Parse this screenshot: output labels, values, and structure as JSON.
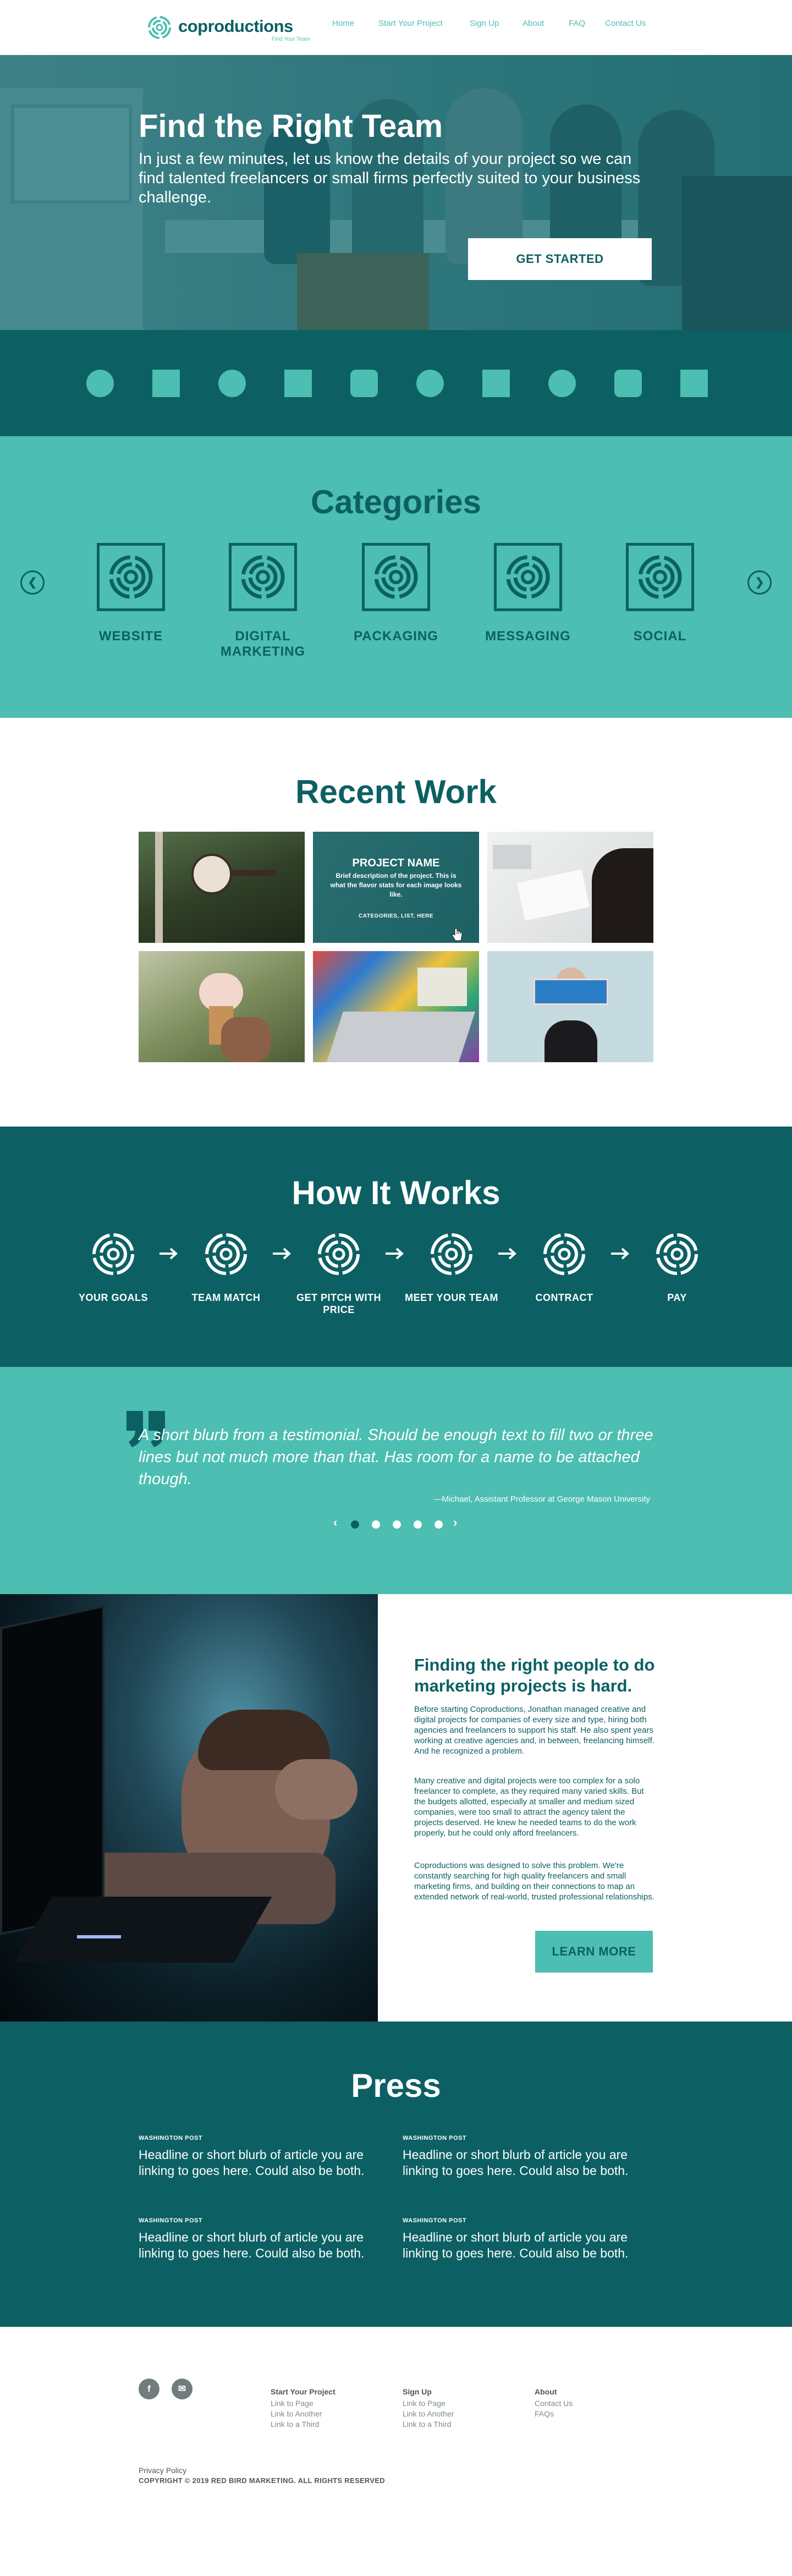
{
  "brand": {
    "name": "coproductions",
    "tagline": "Find Your Team",
    "colors": {
      "dark_teal": "#0c6063",
      "teal": "#4cbeb2",
      "white": "#ffffff",
      "gray": "#717c7c"
    }
  },
  "nav": {
    "items": [
      {
        "label": "Home"
      },
      {
        "label": "Start Your Project"
      },
      {
        "label": "Sign Up"
      },
      {
        "label": "About"
      },
      {
        "label": "FAQ"
      },
      {
        "label": "Contact Us"
      }
    ]
  },
  "hero": {
    "title": "Find the Right Team",
    "subtitle": "In just a few minutes, let us know the details of your project so we can find talented freelancers or small firms perfectly suited to your business challenge.",
    "cta_label": "GET STARTED"
  },
  "client_strip": {
    "shapes": [
      "circle",
      "square",
      "circle",
      "square",
      "rounded-square",
      "circle",
      "square",
      "circle",
      "rounded-square",
      "square"
    ]
  },
  "categories": {
    "title": "Categories",
    "prev_icon": "chevron-left-icon",
    "next_icon": "chevron-right-icon",
    "items": [
      {
        "label": "WEBSITE"
      },
      {
        "label": "DIGITAL MARKETING"
      },
      {
        "label": "PACKAGING"
      },
      {
        "label": "MESSAGING"
      },
      {
        "label": "SOCIAL"
      }
    ]
  },
  "recent_work": {
    "title": "Recent Work",
    "hover_project": {
      "name": "PROJECT NAME",
      "description": "Brief description of the project. This is what the flavor stats for each image looks like.",
      "categories": "CATEGORIES, LIST, HERE"
    }
  },
  "how_it_works": {
    "title": "How It Works",
    "steps": [
      {
        "label": "YOUR GOALS"
      },
      {
        "label": "TEAM MATCH"
      },
      {
        "label": "GET PITCH WITH PRICE"
      },
      {
        "label": "MEET YOUR TEAM"
      },
      {
        "label": "CONTRACT"
      },
      {
        "label": "PAY"
      }
    ]
  },
  "testimonial": {
    "quote": "A short blurb from a testimonial. Should be enough text to fill two or three lines but not much more than that. Has room for a name to be attached though.",
    "attribution": "—Michael, Assistant Professor at George Mason University",
    "prev_label": "‹",
    "next_label": "›",
    "dot_count": 5,
    "active_dot": 1
  },
  "about": {
    "heading": "Finding the right people to do marketing projects is hard.",
    "paragraphs": [
      "Before starting Coproductions, Jonathan managed creative and digital projects for companies of every size and type, hiring both agencies and freelancers to support his staff. He also spent years working at creative agencies and, in between, freelancing himself. And he recognized a problem.",
      "Many creative and digital projects were too complex for a solo freelancer to complete, as they required many varied skills. But the budgets allotted, especially at smaller and medium sized companies, were too small to attract the agency talent the projects deserved. He knew he needed teams to do the work properly, but he could only afford freelancers.",
      "Coproductions was designed to solve this problem. We're constantly searching for high quality freelancers and small marketing firms, and building on their connections to map an extended network of real-world, trusted professional relationships."
    ],
    "cta_label": "LEARN MORE"
  },
  "press": {
    "title": "Press",
    "items": [
      {
        "source": "WASHINGTON POST",
        "headline": "Headline or short blurb of article you are linking to goes here. Could also be both."
      },
      {
        "source": "WASHINGTON POST",
        "headline": "Headline or short blurb of article you are linking to goes here. Could also be both."
      },
      {
        "source": "WASHINGTON POST",
        "headline": "Headline or short blurb of article you are linking to goes here. Could also be both."
      },
      {
        "source": "WASHINGTON POST",
        "headline": "Headline or short blurb of article you are linking to goes here. Could also be both."
      }
    ]
  },
  "footer": {
    "social": [
      {
        "icon": "facebook-icon",
        "glyph": "f"
      },
      {
        "icon": "mail-icon",
        "glyph": "✉"
      }
    ],
    "columns": [
      {
        "heading": "Start Your Project",
        "links": [
          "Link to Page",
          "Link to Another",
          "Link to a Third"
        ]
      },
      {
        "heading": "Sign Up",
        "links": [
          "Link to Page",
          "Link to Another",
          "Link to a Third"
        ]
      },
      {
        "heading": "About",
        "links": [
          "Contact Us",
          "FAQs"
        ]
      }
    ],
    "privacy": "Privacy Policy",
    "copyright": "COPYRIGHT © 2019 RED BIRD MARKETING. ALL RIGHTS RESERVED"
  }
}
